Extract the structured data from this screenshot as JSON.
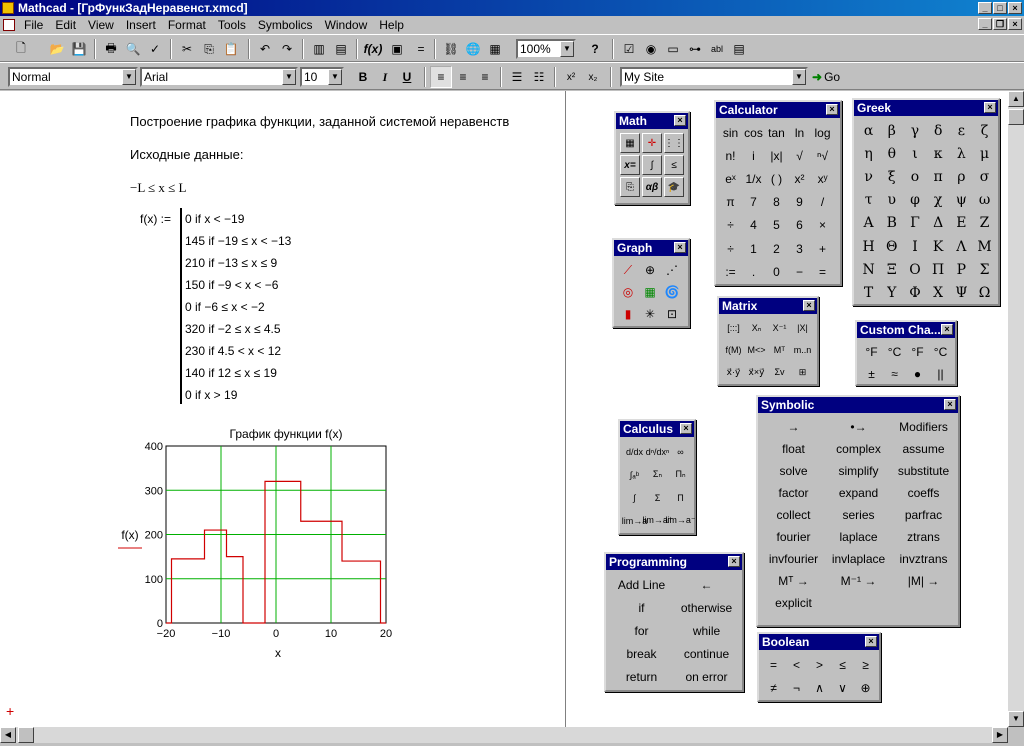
{
  "window": {
    "title": "Mathcad - [ГрФункЗадНеравенст.xmcd]"
  },
  "menu": [
    "File",
    "Edit",
    "View",
    "Insert",
    "Format",
    "Tools",
    "Symbolics",
    "Window",
    "Help"
  ],
  "toolbar": {
    "style": "Normal",
    "font": "Arial",
    "size": "10",
    "zoom": "100%",
    "url": "My Site",
    "go_label": "Go",
    "bold": "B",
    "italic": "I",
    "underline": "U"
  },
  "document": {
    "heading": "Построение графика функции, заданной системой неравенств",
    "input_label": "Исходные данные:",
    "range": "−L ≤ x ≤ L",
    "fdef": "f(x) :=",
    "cases": [
      "0  if  x < −19",
      "145  if  −19 ≤ x < −13",
      "210  if  −13 ≤ x ≤ 9",
      "150  if  −9 < x < −6",
      "0  if  −6 ≤ x < −2",
      "320  if  −2 ≤ x ≤ 4.5",
      "230  if  4.5 < x < 12",
      "140  if  12 ≤ x ≤ 19",
      "0  if  x > 19"
    ]
  },
  "chart_data": {
    "type": "line",
    "title": "График функции f(x)",
    "xlabel": "x",
    "ylabel": "f(x)",
    "xlim": [
      -20,
      20
    ],
    "ylim": [
      0,
      400
    ],
    "xticks": [
      "−20",
      "−10",
      "0",
      "10",
      "20"
    ],
    "yticks": [
      "0",
      "100",
      "200",
      "300",
      "400"
    ],
    "grid": true,
    "color": "#d00000",
    "series": [
      {
        "x": [
          -20,
          -19,
          -19,
          -13,
          -13,
          -9,
          -9,
          -6,
          -6,
          -2,
          -2,
          4.5,
          4.5,
          12,
          12,
          19,
          19,
          20
        ],
        "y": [
          0,
          0,
          145,
          145,
          210,
          210,
          150,
          150,
          0,
          0,
          320,
          320,
          230,
          230,
          140,
          140,
          0,
          0
        ]
      }
    ]
  },
  "palettes": {
    "math": {
      "title": "Math"
    },
    "graph": {
      "title": "Graph"
    },
    "calculator": {
      "title": "Calculator",
      "keys": [
        "sin",
        "cos",
        "tan",
        "ln",
        "log",
        "n!",
        "i",
        "|x|",
        "√",
        "ⁿ√",
        "eˣ",
        "1/x",
        "( )",
        "x²",
        "xʸ",
        "π",
        "7",
        "8",
        "9",
        "/",
        "÷",
        "4",
        "5",
        "6",
        "×",
        "÷",
        "1",
        "2",
        "3",
        "+",
        ":=",
        ".",
        "0",
        "−",
        "="
      ]
    },
    "greek": {
      "title": "Greek",
      "letters": [
        "α",
        "β",
        "γ",
        "δ",
        "ε",
        "ζ",
        "η",
        "θ",
        "ι",
        "κ",
        "λ",
        "μ",
        "ν",
        "ξ",
        "ο",
        "π",
        "ρ",
        "σ",
        "τ",
        "υ",
        "φ",
        "χ",
        "ψ",
        "ω",
        "Α",
        "Β",
        "Γ",
        "Δ",
        "Ε",
        "Ζ",
        "Η",
        "Θ",
        "Ι",
        "Κ",
        "Λ",
        "Μ",
        "Ν",
        "Ξ",
        "Ο",
        "Π",
        "Ρ",
        "Σ",
        "Τ",
        "Υ",
        "Φ",
        "Χ",
        "Ψ",
        "Ω"
      ]
    },
    "matrix": {
      "title": "Matrix",
      "keys": [
        "[:::]",
        "Xₙ",
        "X⁻¹",
        "|X|",
        "f(M)",
        "M<>",
        "Mᵀ",
        "m..n",
        "x⃗·y⃗",
        "x⃗×y⃗",
        "Σv",
        "⊞"
      ]
    },
    "custom": {
      "title": "Custom Cha...",
      "keys": [
        "°F",
        "°C",
        "°F",
        "°C",
        "±",
        "≈",
        "●",
        "||"
      ]
    },
    "symbolic": {
      "title": "Symbolic",
      "keys": [
        "→",
        "•→",
        "Modifiers",
        "float",
        "complex",
        "assume",
        "solve",
        "simplify",
        "substitute",
        "factor",
        "expand",
        "coeffs",
        "collect",
        "series",
        "parfrac",
        "fourier",
        "laplace",
        "ztrans",
        "invfourier",
        "invlaplace",
        "invztrans",
        "Mᵀ →",
        "M⁻¹ →",
        "|M| →",
        "explicit",
        "",
        ""
      ]
    },
    "calculus": {
      "title": "Calculus",
      "keys": [
        "d/dx",
        "dⁿ/dxⁿ",
        "∞",
        "∫ₐᵇ",
        "Σₙ",
        "Πₙ",
        "∫",
        "Σ",
        "Π",
        "lim→a",
        "lim→a⁺",
        "lim→a⁻"
      ]
    },
    "programming": {
      "title": "Programming",
      "keys": [
        "Add Line",
        "←",
        "if",
        "otherwise",
        "for",
        "while",
        "break",
        "continue",
        "return",
        "on error"
      ]
    },
    "boolean": {
      "title": "Boolean",
      "keys": [
        "=",
        "<",
        ">",
        "≤",
        "≥",
        "≠",
        "¬",
        "∧",
        "∨",
        "⊕"
      ]
    }
  }
}
